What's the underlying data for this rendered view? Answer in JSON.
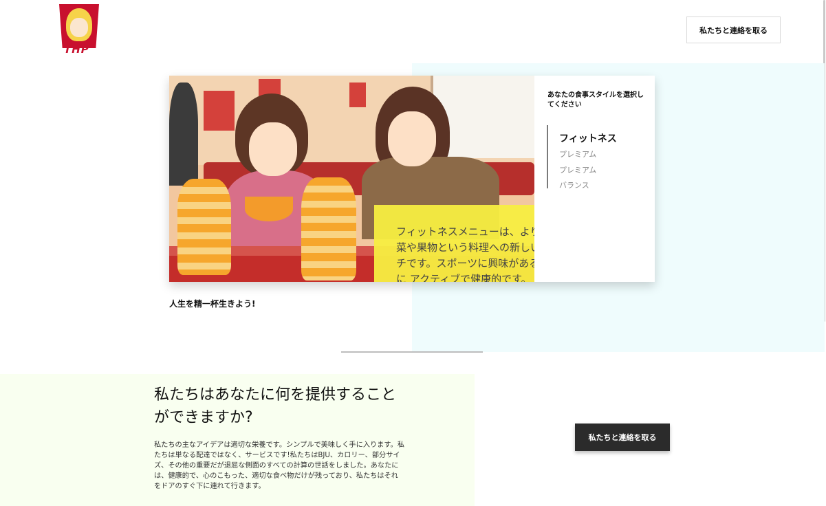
{
  "header": {
    "logo_text": "THP",
    "contact_label": "私たちと連絡を取る"
  },
  "hero": {
    "image_caption": "フィットネスメニューは、より\n菜や果物という料理への新しい\nチです。スポーツに興味がある\nに アクティブで健康的です。",
    "menu_title": "あなたの食事スタイルを選択してください",
    "menu_items": [
      {
        "label": "フィットネス",
        "active": true
      },
      {
        "label": "プレミアム",
        "active": false
      },
      {
        "label": "プレミアム",
        "active": false
      },
      {
        "label": "バランス",
        "active": false
      }
    ],
    "tagline": "人生を精一杯生きよう!"
  },
  "offer": {
    "heading": "私たちはあなたに何を提供することができますか?",
    "body": "私たちの主なアイデアは適切な栄養です。シンプルで美味しく手に入ります。私たちは単なる配達ではなく、サービスです!私たちはBJU、カロリー、部分サイズ、その他の重要だが退屈な側面のすべての計算の世話をしました。あなたには、健康的で、心のこもった、適切な食べ物だけが残っており、私たちはそれをドアのすぐ下に連れて行きます。",
    "contact_label": "私たちと連絡を取る"
  }
}
